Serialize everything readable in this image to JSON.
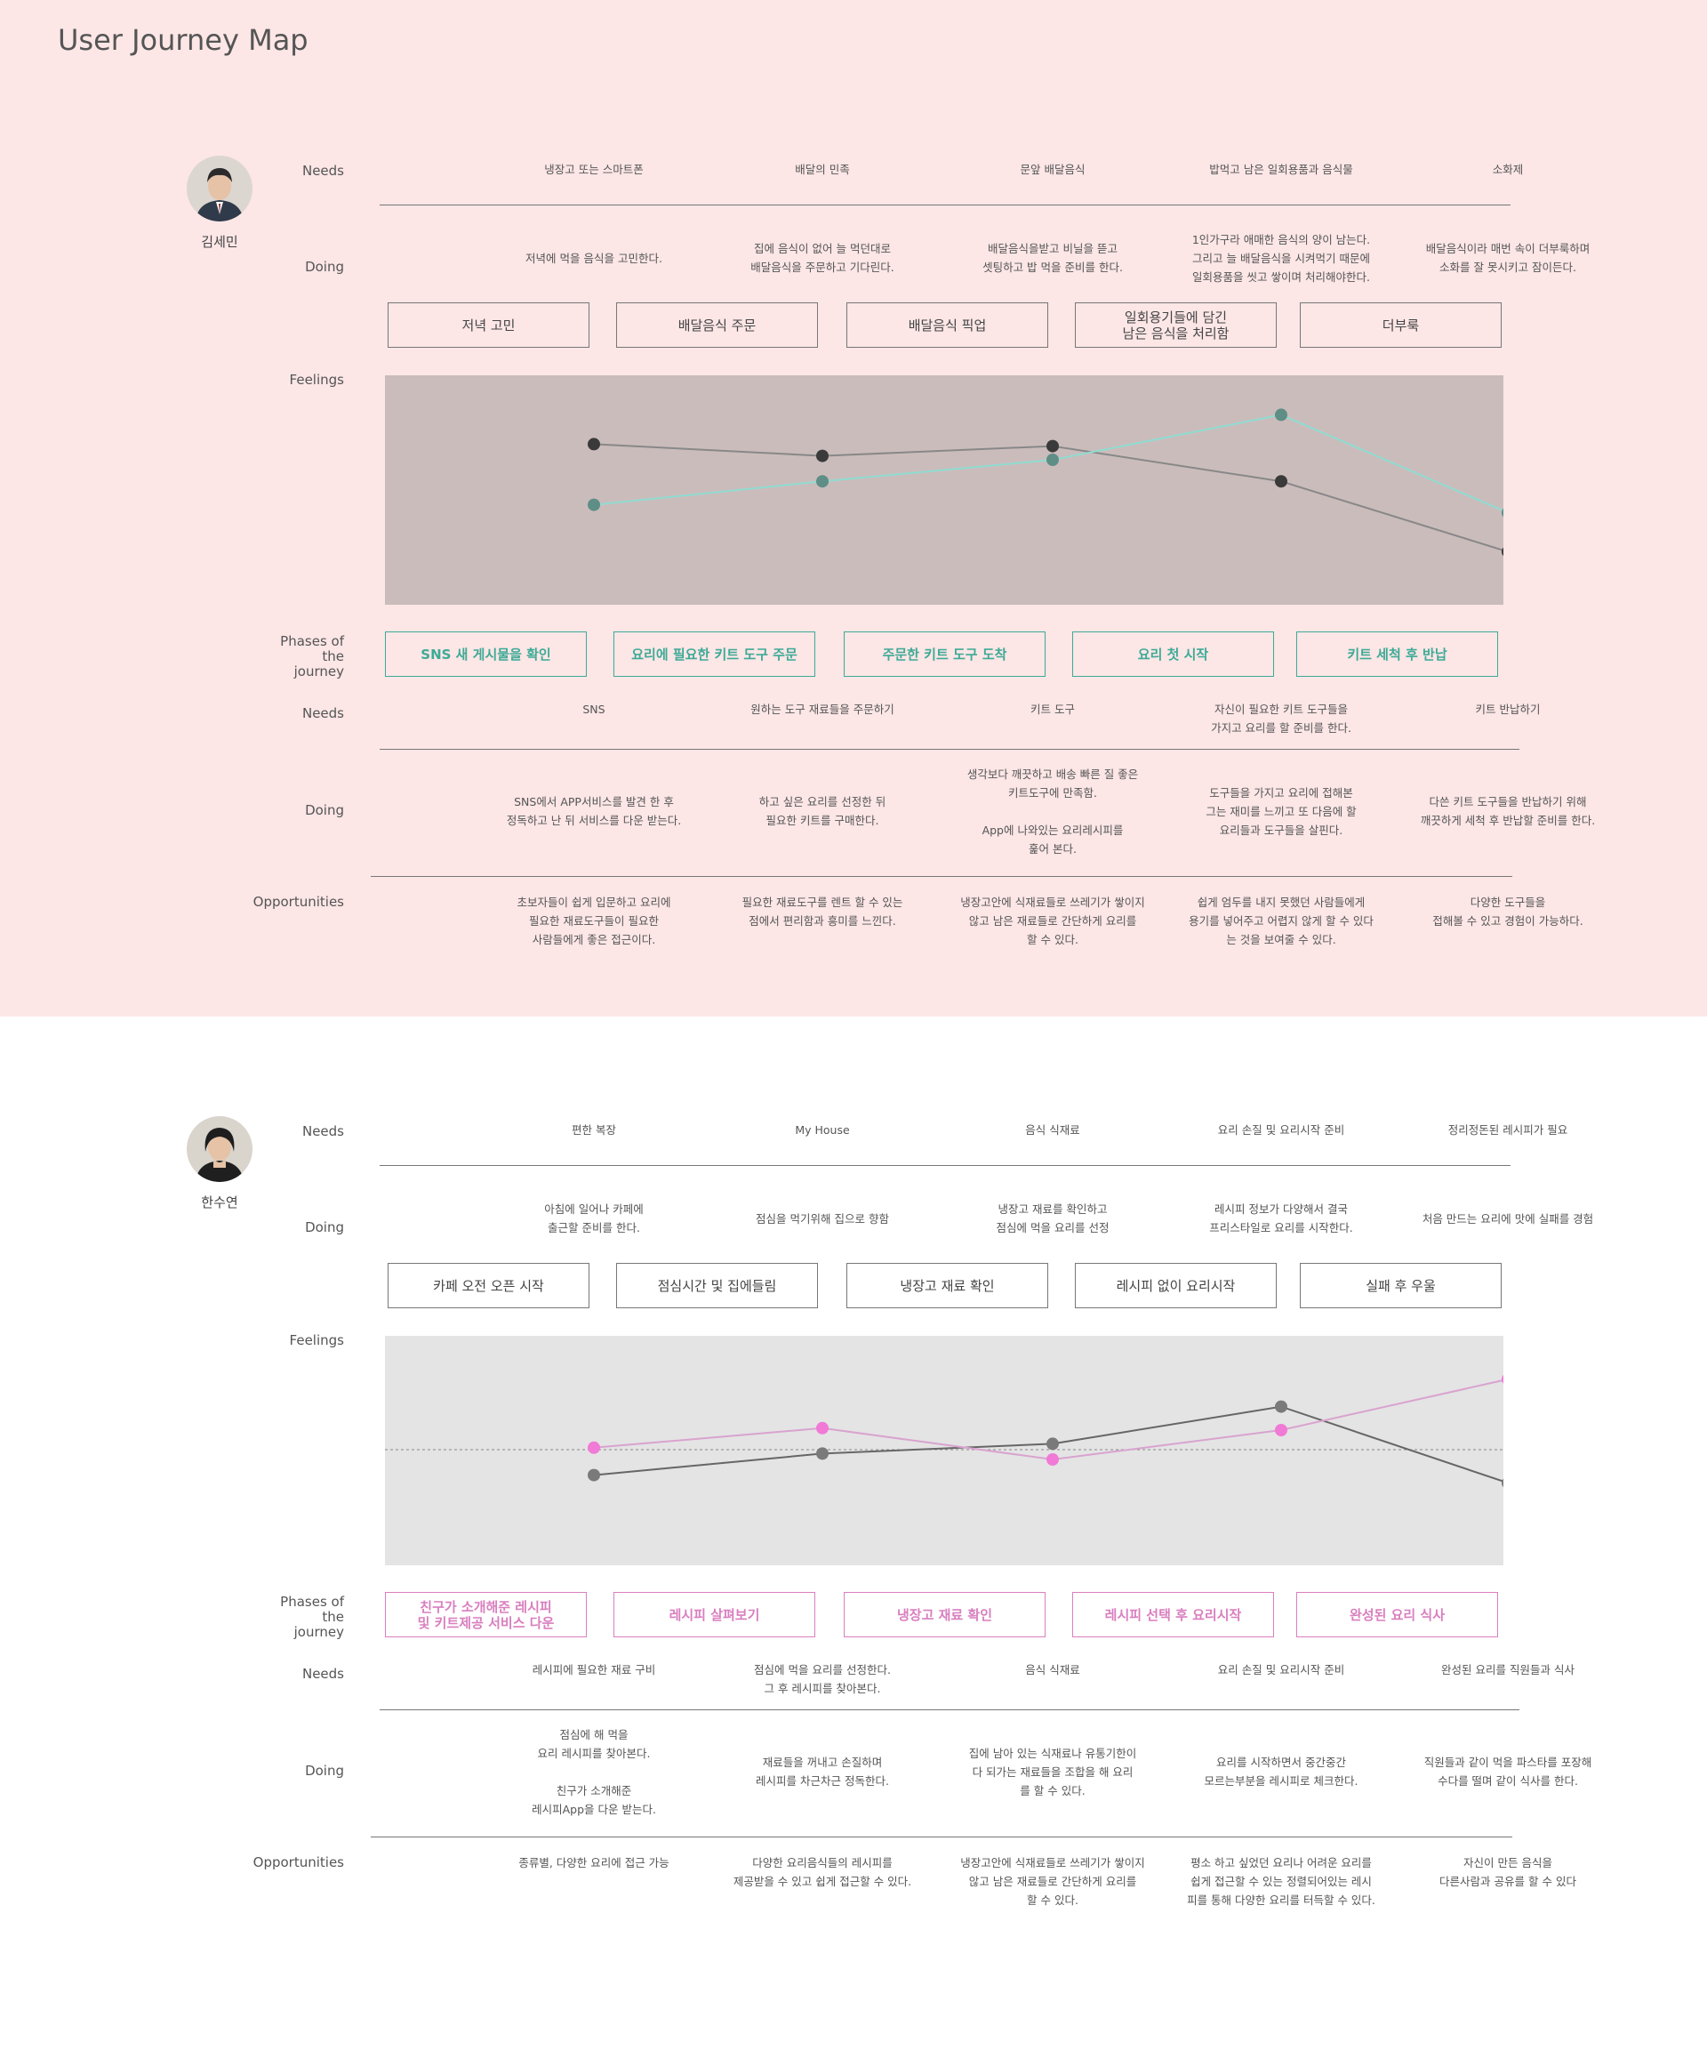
{
  "page": {
    "title": "User Journey Map"
  },
  "row_labels": {
    "needs": "Needs",
    "doing": "Doing",
    "feelings": "Feelings",
    "phases": "Phases of\nthe\njourney",
    "opportunities": "Opportunities"
  },
  "personas": [
    {
      "name": "김세민",
      "top_needs": [
        "냉장고 또는 스마트폰",
        "배달의 민족",
        "문앞 배달음식",
        "밥먹고 남은 일회용품과 음식물",
        "소화제"
      ],
      "top_doing": [
        "저녁에 먹을 음식을 고민한다.",
        "집에 음식이 없어 늘 먹던대로\n배달음식을 주문하고 기다린다.",
        "배달음식을받고 비닐을 뜯고\n셋팅하고 밥 먹을 준비를 한다.",
        "1인가구라 애매한 음식의 양이 남는다.\n그리고 늘 배달음식을 시켜먹기 때문에\n일회용품을 씻고 쌓이며 처리해야한다.",
        "배달음식이라 매번 속이 더부룩하며\n소화를 잘 못시키고 잠이든다."
      ],
      "boxes": [
        "저녁 고민",
        "배달음식 주문",
        "배달음식 픽업",
        "일회용기들에 담긴\n남은 음식을 처리함",
        "더부룩"
      ],
      "phases": [
        "SNS 새 게시물을 확인",
        "요리에 필요한 키트 도구 주문",
        "주문한 키트 도구 도착",
        "요리 첫 시작",
        "키트 세척 후 반납"
      ],
      "needs2": [
        "SNS",
        "원하는 도구 재료들을 주문하기",
        "키트 도구",
        "자신이 필요한 키트 도구들을\n가지고 요리를 할 준비를 한다.",
        "키트 반납하기"
      ],
      "doing2": [
        "SNS에서 APP서비스를 발견 한 후\n정독하고 난 뒤 서비스를 다운 받는다.",
        "하고 싶은 요리를 선정한 뒤\n필요한 키트를 구매한다.",
        "생각보다 깨끗하고 배송 빠른 질 좋은\n키트도구에 만족함.\n\nApp에 나와있는 요리레시피를\n훑어 본다.",
        "도구들을 가지고 요리에 접해본\n그는 재미를 느끼고 또 다음에 할\n요리들과 도구들을 살핀다.",
        "다쓴 키트 도구들을 반납하기 위해\n깨끗하게  세척 후 반납할 준비를 한다."
      ],
      "opportunities": [
        "초보자들이 쉽게 입문하고 요리에\n필요한 재료도구들이 필요한\n사람들에게 좋은 접근이다.",
        "필요한 재료도구를 렌트 할 수 있는\n점에서 편리함과 흥미를 느낀다.",
        "냉장고안에 식재료들로 쓰레기가 쌓이지\n않고 남은 재료들로 간단하게 요리를\n할 수 있다.",
        "쉽게 엄두를 내지 못했던 사람들에게\n용기를 넣어주고 어렵지 않게 할 수 있다\n는 것을 보여줄 수 있다.",
        "다양한 도구들을\n접해볼 수 있고 경험이 가능하다."
      ],
      "colors": {
        "accent": "#3daa96",
        "chart_bg": "#cbbcbc",
        "series_a": "#888888",
        "series_b": "#8fdcd0"
      },
      "chart_data": {
        "type": "line",
        "categories": [
          "1",
          "2",
          "3",
          "4",
          "5"
        ],
        "ylim": [
          0,
          10
        ],
        "series": [
          {
            "values": [
              7.3,
              6.7,
              7.2,
              5.4,
              1.8
            ],
            "marker": "#3a3a3a",
            "line": "#888888"
          },
          {
            "values": [
              4.2,
              5.4,
              6.5,
              8.8,
              3.8
            ],
            "marker": "#5e8e86",
            "line": "#8fdcd0"
          }
        ],
        "grid": false
      }
    },
    {
      "name": "한수연",
      "top_needs": [
        "편한 복장",
        "My House",
        "음식 식재료",
        "요리 손질 및 요리시작 준비",
        "정리정돈된 레시피가 필요"
      ],
      "top_doing": [
        "아침에 일어나 카페에\n출근할 준비를 한다.",
        "점심을 먹기위해 집으로 향함",
        "냉장고 재료를 확인하고\n점심에 먹을 요리를 선정",
        "레시피 정보가 다양해서 결국\n프리스타일로 요리를 시작한다.",
        "처음 만드는 요리에 맛에 실패를 경험"
      ],
      "boxes": [
        "카페 오전 오픈 시작",
        "점심시간 및 집에들림",
        "냉장고 재료 확인",
        "레시피 없이 요리시작",
        "실패 후 우울"
      ],
      "phases": [
        "친구가 소개해준 레시피\n및 키트제공 서비스 다운",
        "레시피 살펴보기",
        "냉장고 재료 확인",
        "레시피 선택 후 요리시작",
        "완성된 요리 식사"
      ],
      "needs2": [
        "레시피에 필요한 재료 구비",
        "점심에 먹을 요리를 선정한다.\n그 후 레시피를 찾아본다.",
        "음식 식재료",
        "요리 손질 및 요리시작 준비",
        "완성된 요리를 직원들과 식사"
      ],
      "doing2": [
        "점심에 해 먹을\n요리 레시피를 찾아본다.\n\n친구가 소개해준\n레시피App을 다운 받는다.",
        "재료들을 꺼내고 손질하며\n레시피를 차근차근 정독한다.",
        "집에 남아 있는 식재료나 유통기한이\n다 되가는 재료들을 조합을 해 요리\n를 할 수 있다.",
        "요리를 시작하면서 중간중간\n모르는부분을 레시피로 체크한다.",
        "직원들과 같이 먹을 파스타를 포장해\n수다를 떨며 같이 식사를 한다."
      ],
      "opportunities": [
        "종류별, 다양한 요리에 접근 가능",
        "다양한 요리음식들의 레시피를\n제공받을 수 있고 쉽게 접근할 수 있다.",
        "냉장고안에 식재료들로 쓰레기가 쌓이지\n않고 남은 재료들로 간단하게 요리를\n할 수 있다.",
        "평소 하고 싶었던 요리나 어려운 요리를\n쉽게 접근할 수 있는 정렬되어있는 레시\n피를 통해 다양한 요리를 터득할 수 있다.",
        "자신이 만든 음식을\n다른사람과 공유를 할 수 있다"
      ],
      "colors": {
        "accent": "#d97fbf",
        "chart_bg": "#e4e4e4",
        "series_a": "#666666",
        "series_b": "#d9a3cf"
      },
      "chart_data": {
        "type": "line",
        "categories": [
          "1",
          "2",
          "3",
          "4",
          "5"
        ],
        "ylim": [
          0,
          10
        ],
        "series": [
          {
            "values": [
              3.7,
              4.8,
              5.3,
              7.2,
              3.3
            ],
            "marker": "#7a7a7a",
            "line": "#666666"
          },
          {
            "values": [
              5.1,
              6.1,
              4.5,
              6.0,
              8.6
            ],
            "marker": "#f07ad6",
            "line": "#d9a3cf"
          }
        ],
        "grid": false,
        "baseline": 5
      }
    }
  ]
}
